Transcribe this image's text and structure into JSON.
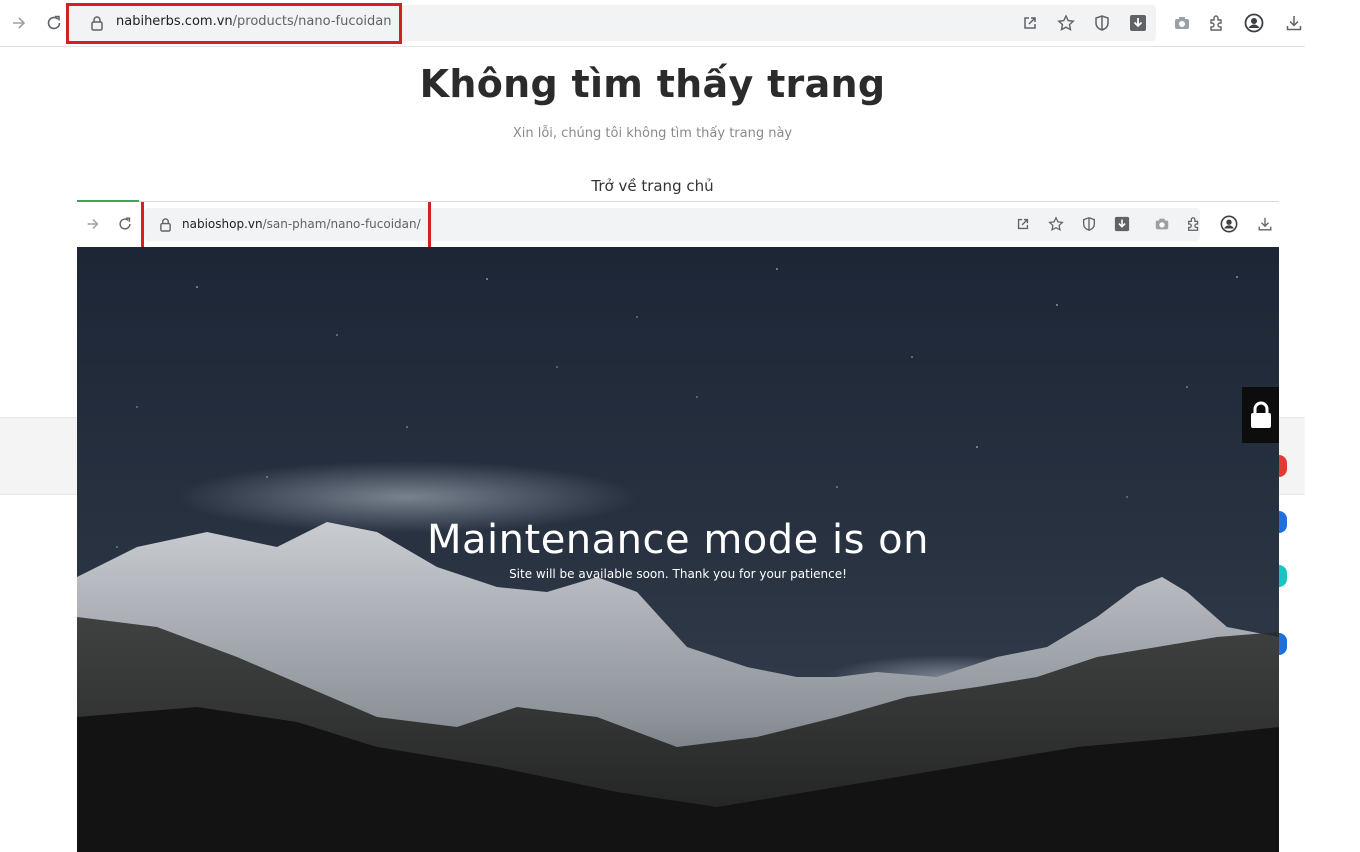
{
  "browser_top": {
    "url_host": "nabiherbs.com.vn",
    "url_path": "/products/nano-fucoidan"
  },
  "not_found": {
    "title": "Không tìm thấy trang",
    "subtitle": "Xin lỗi, chúng tôi không tìm thấy trang này",
    "home_link": "Trở về trang chủ"
  },
  "browser_inner": {
    "url_host": "nabioshop.vn",
    "url_path": "/san-pham/nano-fucoidan/"
  },
  "maintenance": {
    "title": "Maintenance mode is on",
    "subtitle": "Site will be available soon. Thank you for your patience!"
  },
  "colors": {
    "highlight": "#d31f26",
    "side_dots": [
      "#e53935",
      "#1e6fe0",
      "#19c4c4",
      "#1e6fe0"
    ]
  },
  "icons": {
    "toolbar_top": [
      "share-icon",
      "star-icon",
      "shield-icon",
      "download-arrow-icon",
      "camera-icon",
      "extension-icon",
      "profile-icon",
      "download-icon"
    ],
    "toolbar_inner": [
      "share-icon",
      "star-icon",
      "shield-icon",
      "download-arrow-icon",
      "camera-icon",
      "extension-icon",
      "profile-icon",
      "download-icon"
    ]
  }
}
